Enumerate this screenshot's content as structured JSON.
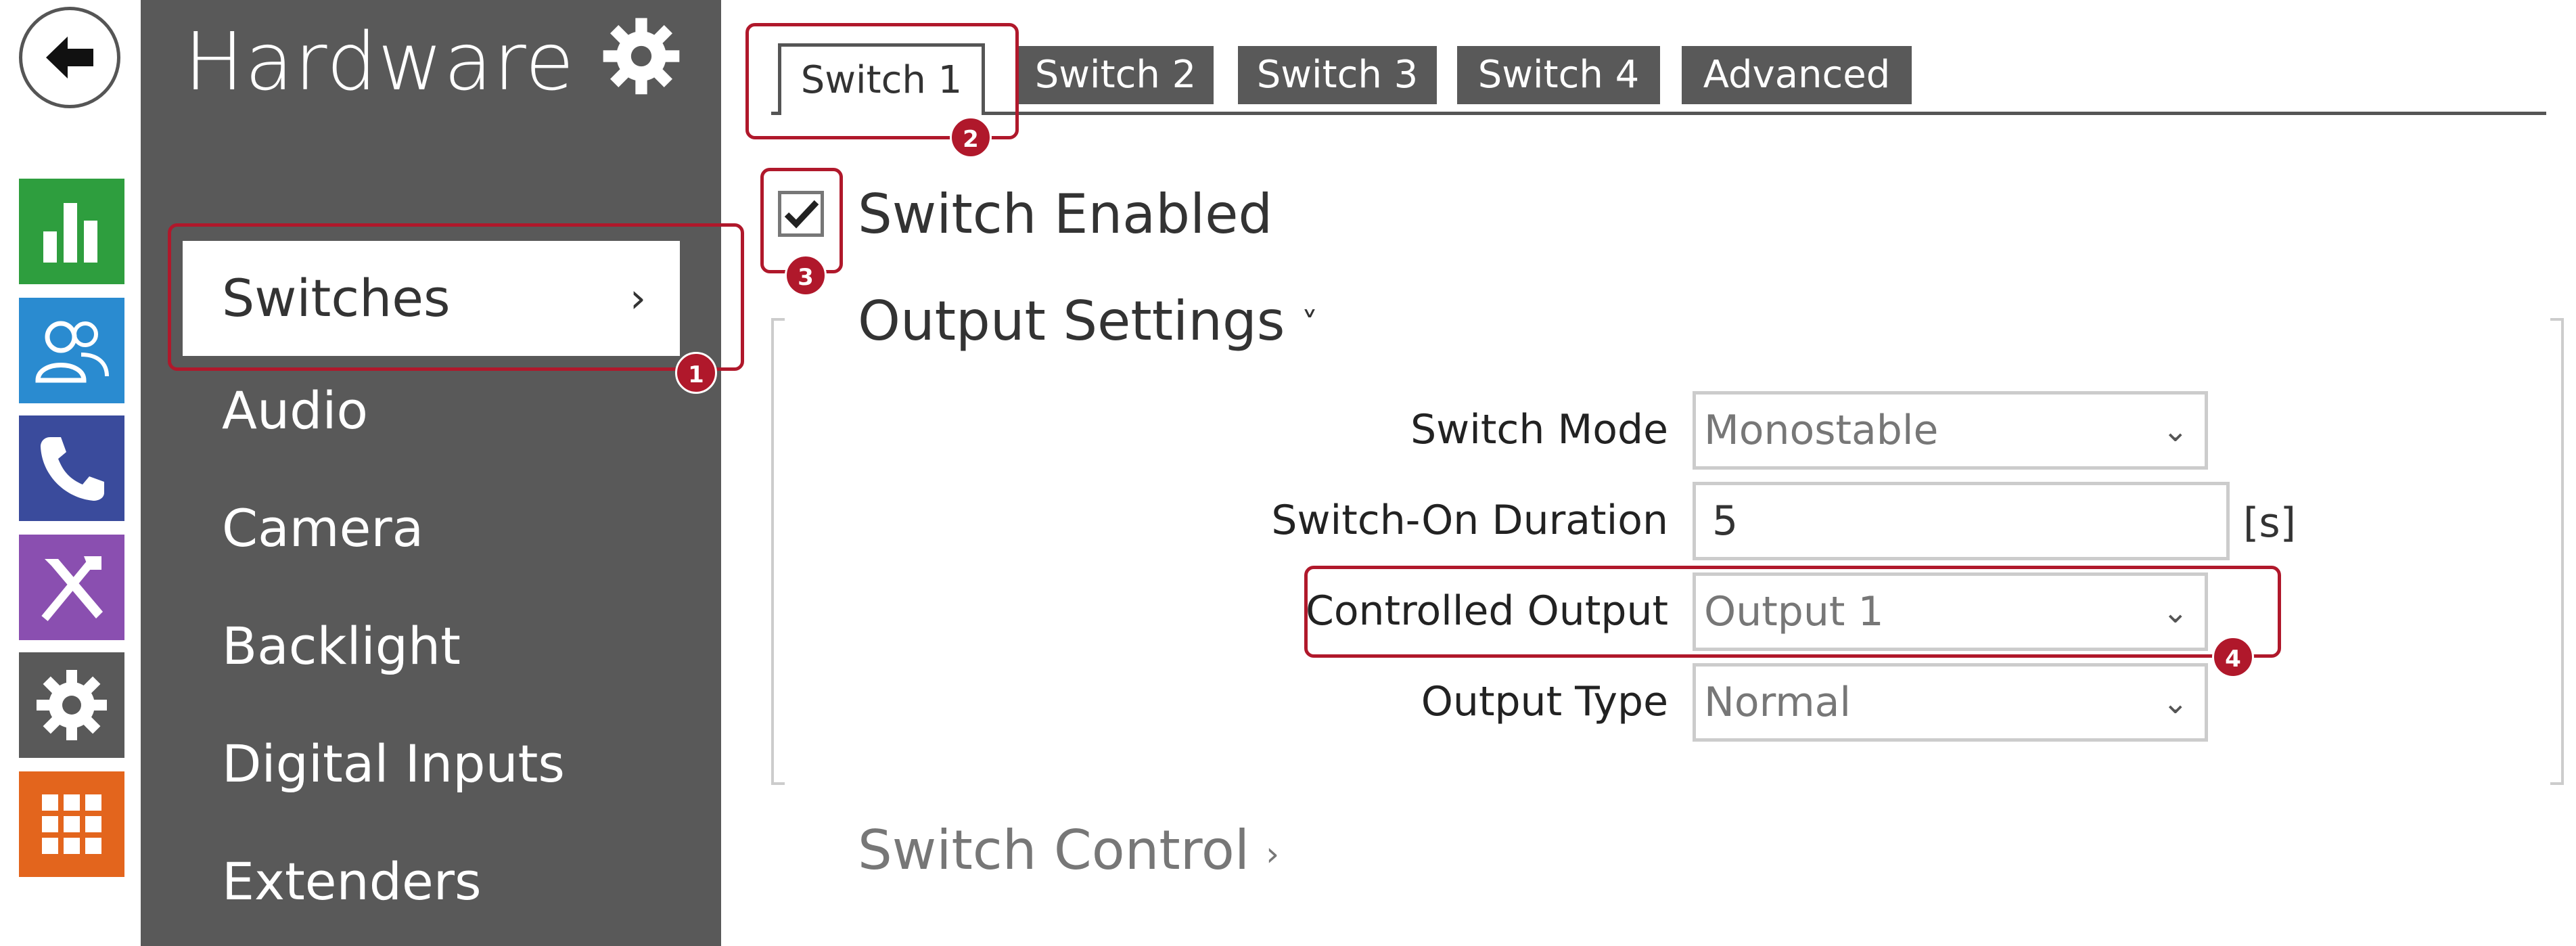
{
  "sidebar": {
    "title": "Hardware",
    "items": [
      {
        "label": "Switches",
        "active": true
      },
      {
        "label": "Audio"
      },
      {
        "label": "Camera"
      },
      {
        "label": "Backlight"
      },
      {
        "label": "Digital Inputs"
      },
      {
        "label": "Extenders"
      }
    ]
  },
  "rail": {
    "tiles": [
      {
        "icon": "chart-icon",
        "color": "#2e9e3e"
      },
      {
        "icon": "users-icon",
        "color": "#2a8bd0"
      },
      {
        "icon": "phone-icon",
        "color": "#3a4b9c"
      },
      {
        "icon": "tools-icon",
        "color": "#8a4fb0"
      },
      {
        "icon": "gear-icon",
        "color": "#595959"
      },
      {
        "icon": "grid-icon",
        "color": "#e3651d"
      }
    ]
  },
  "tabs": [
    {
      "label": "Switch 1",
      "active": true
    },
    {
      "label": "Switch 2"
    },
    {
      "label": "Switch 3"
    },
    {
      "label": "Switch 4"
    },
    {
      "label": "Advanced"
    }
  ],
  "switch_enabled": {
    "label": "Switch Enabled",
    "checked": true
  },
  "output_settings": {
    "title": "Output Settings",
    "chevron": "˅",
    "fields": {
      "switch_mode": {
        "label": "Switch Mode",
        "value": "Monostable"
      },
      "duration": {
        "label": "Switch-On Duration",
        "value": "5",
        "unit": "[s]"
      },
      "controlled_output": {
        "label": "Controlled Output",
        "value": "Output 1"
      },
      "output_type": {
        "label": "Output Type",
        "value": "Normal"
      }
    }
  },
  "switch_control": {
    "title": "Switch Control",
    "chevron": "›"
  },
  "callouts": [
    "1",
    "2",
    "3",
    "4"
  ],
  "colors": {
    "accent": "#b0182b",
    "nav_bg": "#595959"
  }
}
